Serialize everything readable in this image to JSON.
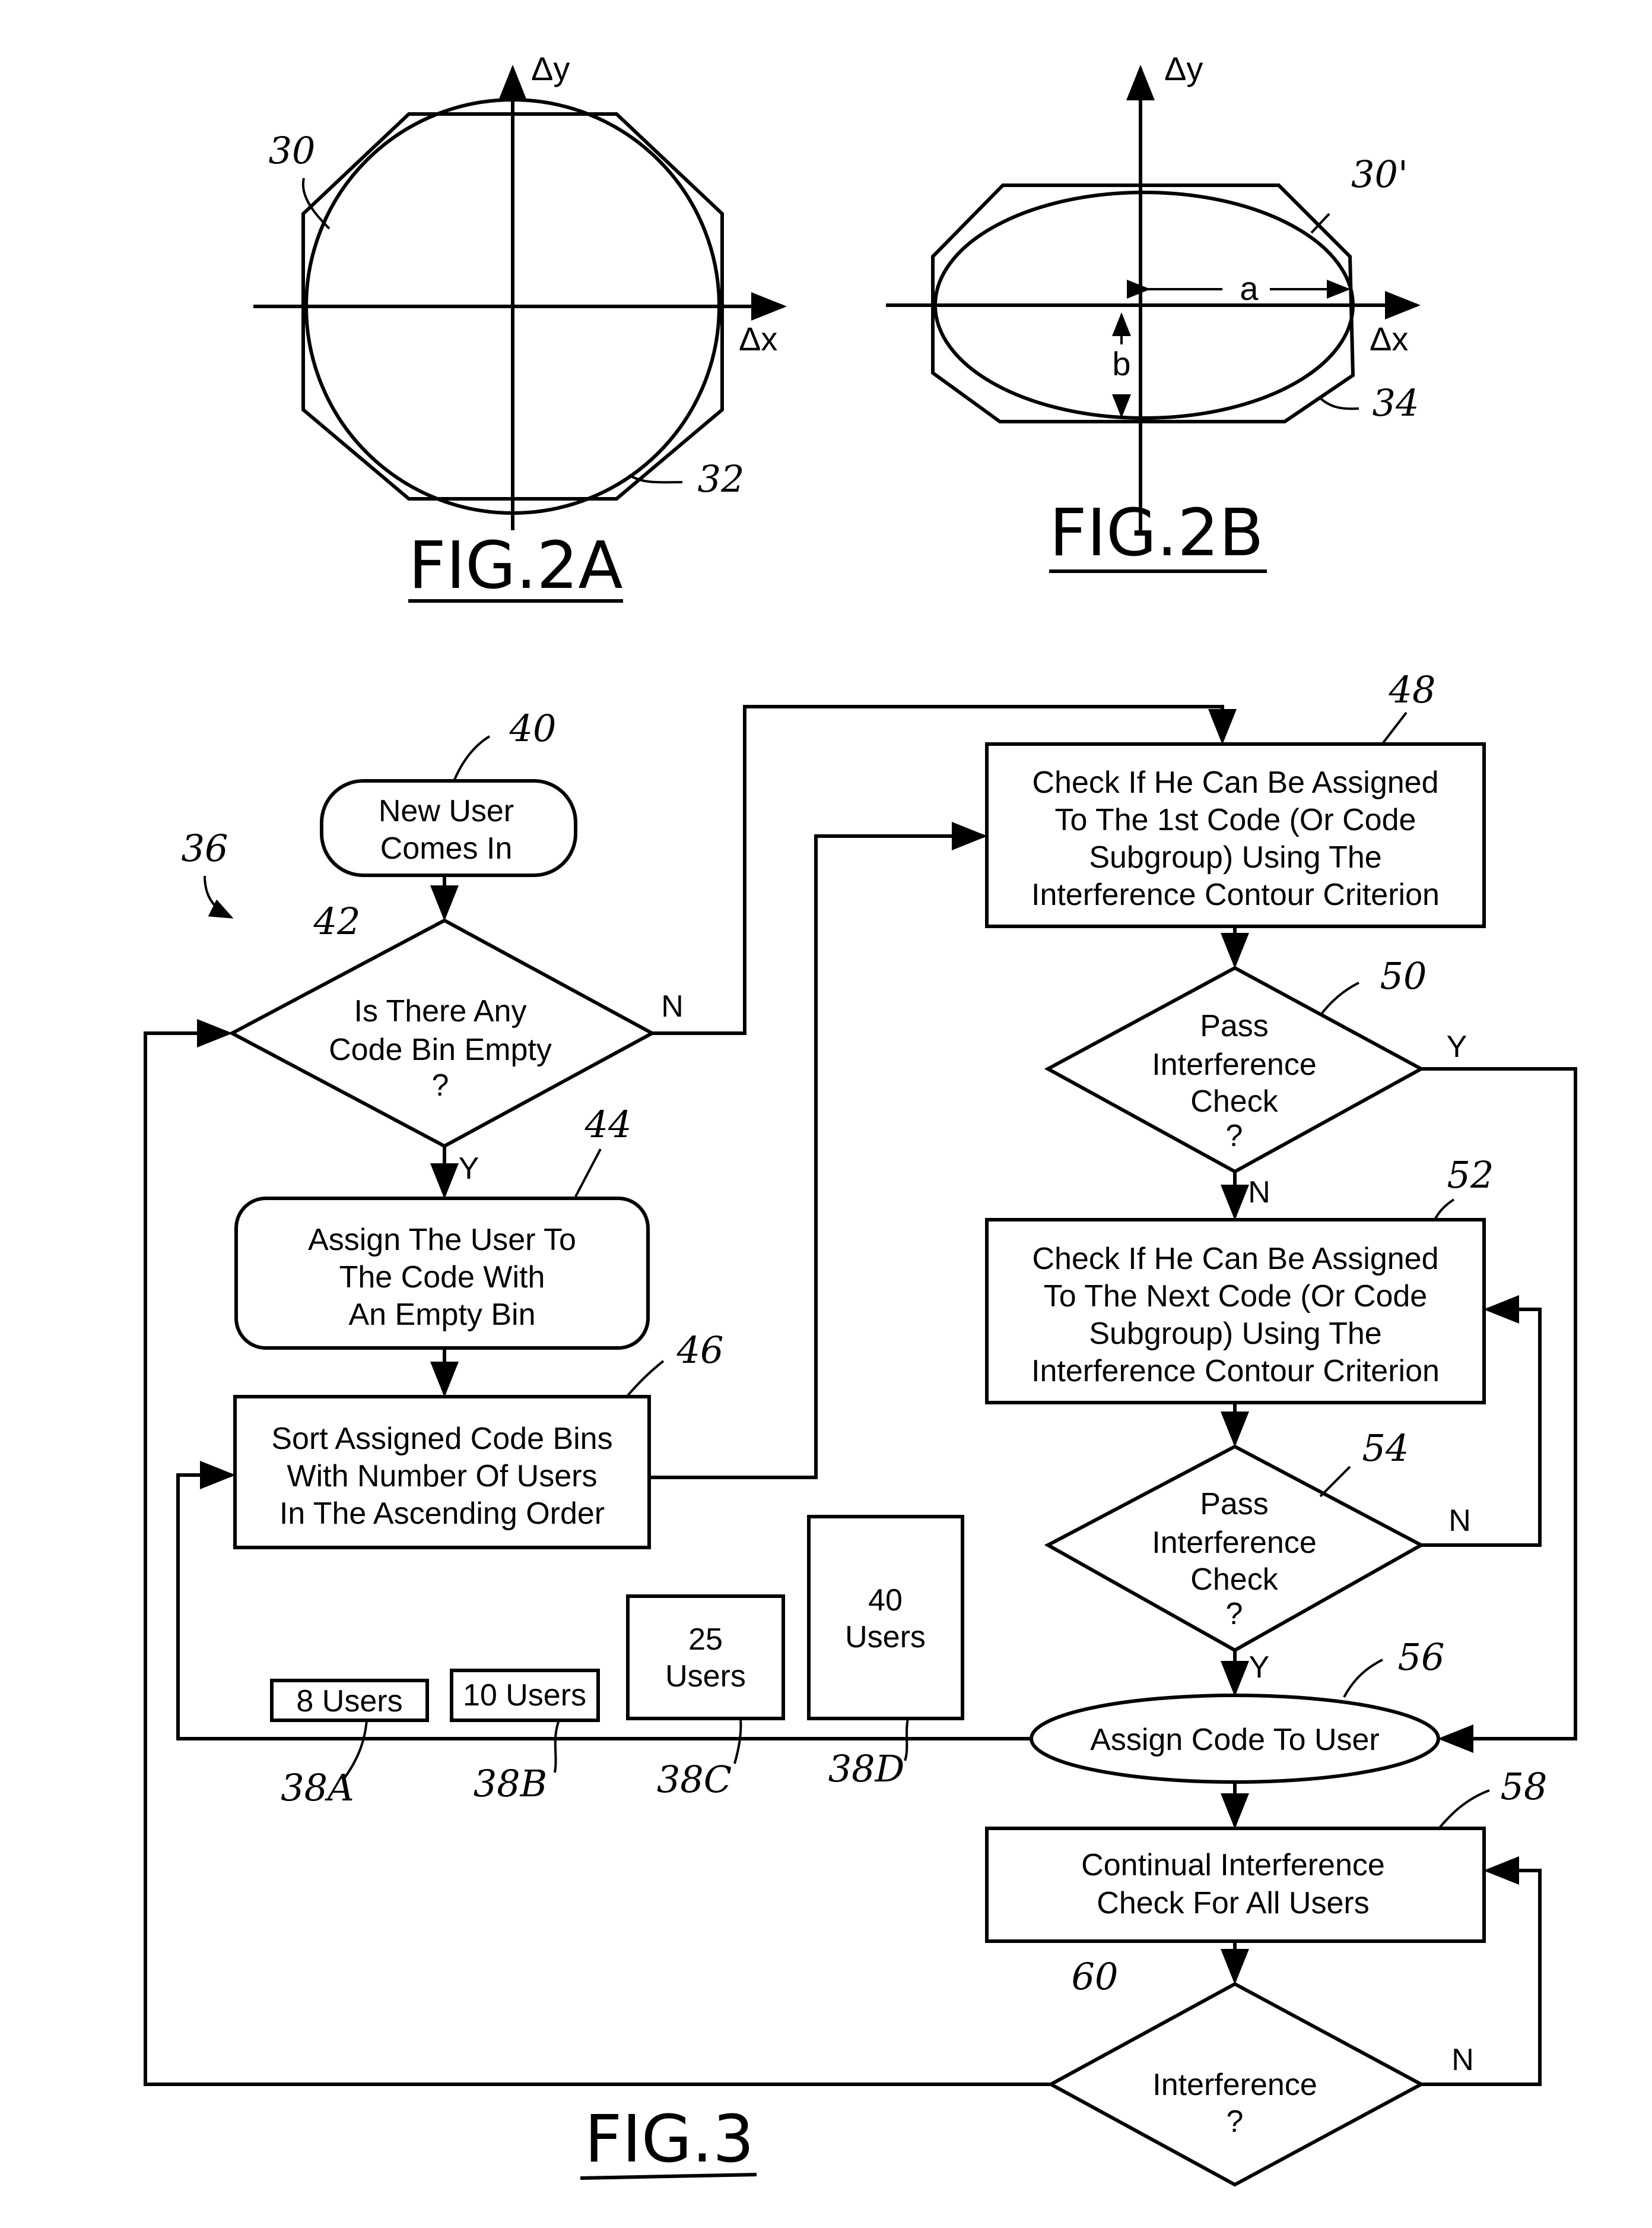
{
  "figures": {
    "fig2a": {
      "caption": "FIG.2A",
      "x_axis_label": "Δx",
      "y_axis_label": "Δy",
      "refs": {
        "contour": "30",
        "octagon": "32"
      }
    },
    "fig2b": {
      "caption": "FIG.2B",
      "x_axis_label": "Δx",
      "y_axis_label": "Δy",
      "semi_major_label": "a",
      "semi_minor_label": "b",
      "refs": {
        "contour": "30'",
        "octagon": "34"
      }
    },
    "fig3": {
      "caption": "FIG.3",
      "flow_ref": "36",
      "nodes": {
        "n40": {
          "ref": "40",
          "lines": [
            "New User",
            "Comes In"
          ]
        },
        "n42": {
          "ref": "42",
          "lines": [
            "Is There Any",
            "Code Bin Empty",
            "?"
          ],
          "yes": "Y",
          "no": "N"
        },
        "n44": {
          "ref": "44",
          "lines": [
            "Assign The User To",
            "The Code With",
            "An Empty Bin"
          ]
        },
        "n46": {
          "ref": "46",
          "lines": [
            "Sort Assigned Code Bins",
            "With Number Of Users",
            "In The Ascending Order"
          ]
        },
        "n48": {
          "ref": "48",
          "lines": [
            "Check If He Can Be Assigned",
            "To The 1st Code (Or Code",
            "Subgroup) Using The",
            "Interference Contour Criterion"
          ]
        },
        "n50": {
          "ref": "50",
          "lines": [
            "Pass",
            "Interference",
            "Check",
            "?"
          ],
          "yes": "Y",
          "no": "N"
        },
        "n52": {
          "ref": "52",
          "lines": [
            "Check If He Can Be Assigned",
            "To The Next Code (Or Code",
            "Subgroup) Using The",
            "Interference Contour Criterion"
          ]
        },
        "n54": {
          "ref": "54",
          "lines": [
            "Pass",
            "Interference",
            "Check",
            "?"
          ],
          "yes": "Y",
          "no": "N"
        },
        "n56": {
          "ref": "56",
          "lines": [
            "Assign Code To User"
          ]
        },
        "n58": {
          "ref": "58",
          "lines": [
            "Continual Interference",
            "Check For All Users"
          ]
        },
        "n60": {
          "ref": "60",
          "lines": [
            "Interference",
            "?"
          ],
          "no": "N"
        }
      },
      "bins": [
        {
          "ref": "38A",
          "lines": [
            "8 Users"
          ],
          "users": 8
        },
        {
          "ref": "38B",
          "lines": [
            "10 Users"
          ],
          "users": 10
        },
        {
          "ref": "38C",
          "lines": [
            "25",
            "Users"
          ],
          "users": 25
        },
        {
          "ref": "38D",
          "lines": [
            "40",
            "Users"
          ],
          "users": 40
        }
      ]
    }
  }
}
